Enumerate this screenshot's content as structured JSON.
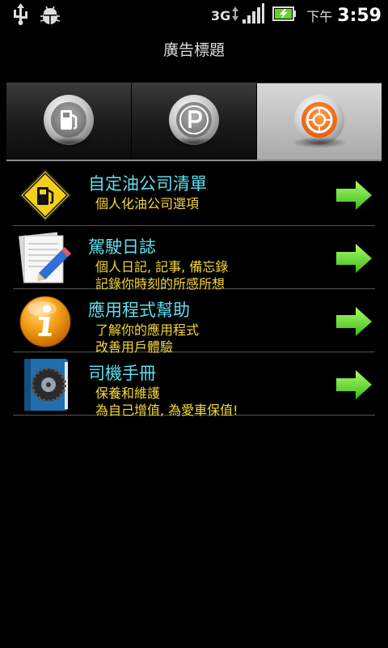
{
  "status_bar": {
    "network": "3G",
    "clock_prefix": "下午",
    "time": "3:59",
    "icons": [
      "usb-icon",
      "debug-bug-icon",
      "signal-icon",
      "battery-charging-icon"
    ]
  },
  "header": {
    "title": "廣告標題"
  },
  "tabs": [
    {
      "name": "fuel-tab",
      "icon": "fuel-pump-icon",
      "active": false
    },
    {
      "name": "parking-tab",
      "icon": "parking-icon",
      "active": false
    },
    {
      "name": "tire-tab",
      "icon": "tire-icon",
      "active": true
    }
  ],
  "menu": {
    "items": [
      {
        "title": "自定油公司清單",
        "subtitle": [
          "個人化油公司選項"
        ],
        "icon": "fuel-sign-icon"
      },
      {
        "title": "駕駛日誌",
        "subtitle": [
          "個人日記, 記事, 備忘錄",
          "記錄你時刻的所感所想"
        ],
        "icon": "notepad-pencil-icon"
      },
      {
        "title": "應用程式幫助",
        "subtitle": [
          "了解你的應用程式",
          "改善用戶體驗"
        ],
        "icon": "info-icon"
      },
      {
        "title": "司機手冊",
        "subtitle": [
          "保養和維護",
          "為自己增值, 為愛車保值!"
        ],
        "icon": "manual-book-icon"
      }
    ]
  },
  "colors": {
    "title_text": "#5fe0f0",
    "subtitle_text": "#f5d73a",
    "arrow": "#5fd32a",
    "active_tab_bg": "#bdbdbd"
  }
}
